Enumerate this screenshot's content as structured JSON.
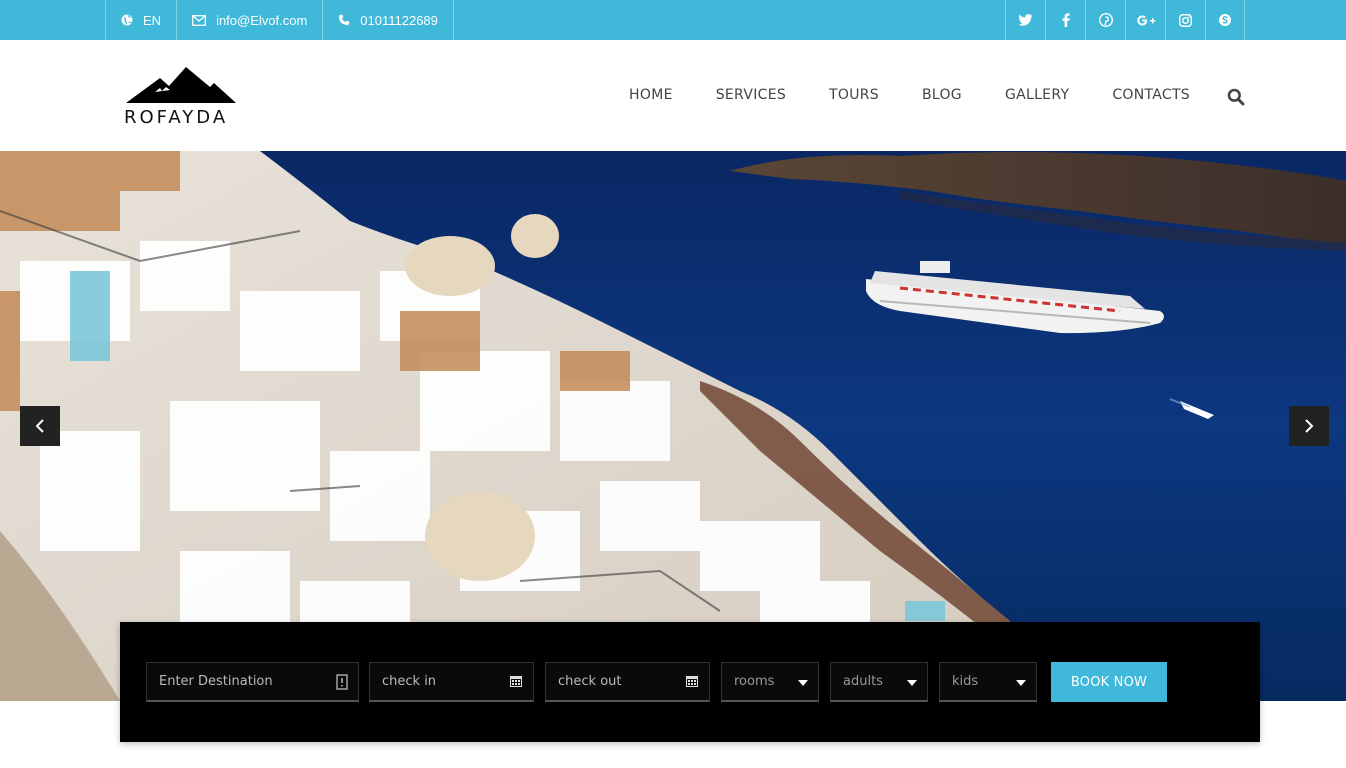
{
  "topbar": {
    "language": "EN",
    "email": "info@Elvof.com",
    "phone": "01011122689",
    "socials": [
      "twitter-icon",
      "facebook-icon",
      "pinterest-icon",
      "google-plus-icon",
      "instagram-icon",
      "skype-icon"
    ]
  },
  "header": {
    "logo_text": "ROFAYDA",
    "nav": [
      "HOME",
      "SERVICES",
      "TOURS",
      "BLOG",
      "GALLERY",
      "CONTACTS"
    ]
  },
  "booking": {
    "destination_placeholder": "Enter Destination",
    "checkin_placeholder": "check in",
    "checkout_placeholder": "check out",
    "rooms": "rooms",
    "adults": "adults",
    "kids": "kids",
    "book_label": "BOOK NOW"
  },
  "colors": {
    "accent": "#3fb8d9",
    "booking_bg": "#000000",
    "sea": "#0b3574"
  }
}
